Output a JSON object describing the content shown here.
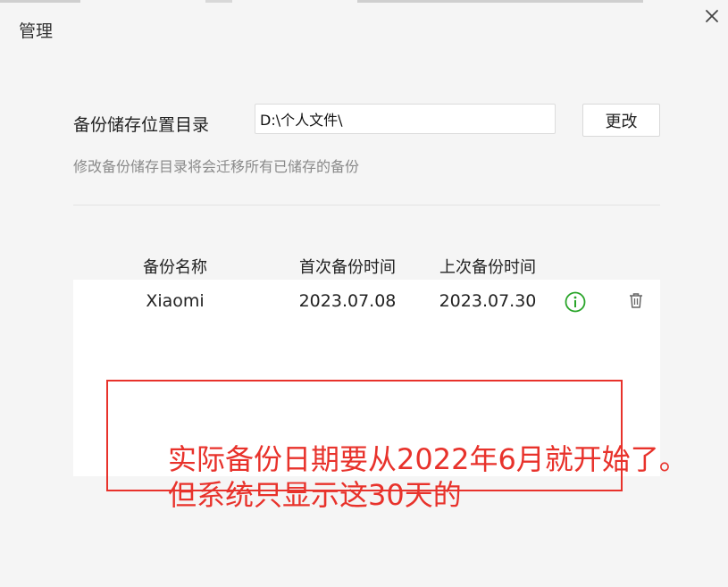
{
  "window": {
    "title": "管理",
    "close_icon": "close-icon"
  },
  "storage": {
    "label": "备份储存位置目录",
    "path_value": "D:\\个人文件\\",
    "change_button": "更改",
    "hint": "修改备份储存目录将会迁移所有已储存的备份"
  },
  "table": {
    "headers": [
      "备份名称",
      "首次备份时间",
      "上次备份时间"
    ],
    "rows": [
      {
        "name": "Xiaomi",
        "first_backup": "2023.07.08",
        "last_backup": "2023.07.30",
        "info_icon": "info-icon",
        "delete_icon": "trash-icon"
      }
    ]
  },
  "annotation": {
    "color": "#e8322b",
    "line1": "实际备份日期要从2022年6月就开始了。",
    "line2": "但系统只显示这30天的"
  },
  "colors": {
    "info_green": "#2aa52a",
    "hint_gray": "#8a8a8a"
  }
}
